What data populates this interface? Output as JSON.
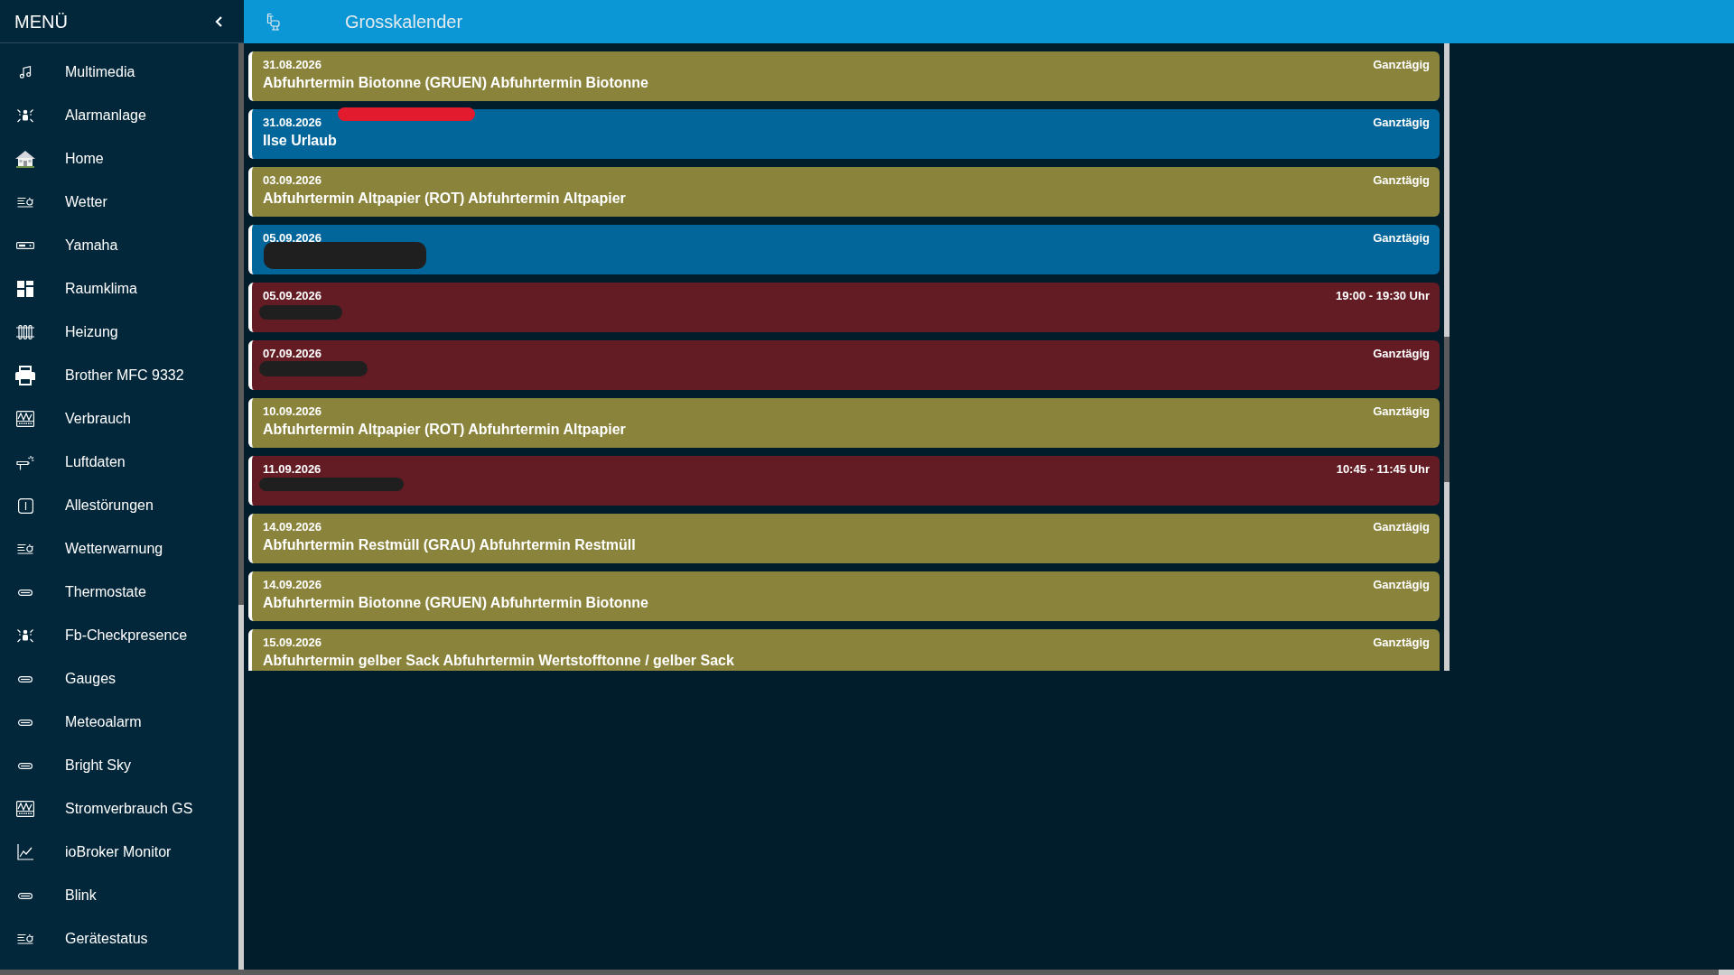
{
  "sidebar": {
    "title": "MENÜ",
    "items": [
      {
        "label": "Multimedia"
      },
      {
        "label": "Alarmanlage"
      },
      {
        "label": "Home"
      },
      {
        "label": "Wetter"
      },
      {
        "label": "Yamaha"
      },
      {
        "label": "Raumklima"
      },
      {
        "label": "Heizung"
      },
      {
        "label": "Brother MFC 9332"
      },
      {
        "label": "Verbrauch"
      },
      {
        "label": "Luftdaten"
      },
      {
        "label": "Allestörungen"
      },
      {
        "label": "Wetterwarnung"
      },
      {
        "label": "Thermostate"
      },
      {
        "label": "Fb-Checkpresence"
      },
      {
        "label": "Gauges"
      },
      {
        "label": "Meteoalarm"
      },
      {
        "label": "Bright Sky"
      },
      {
        "label": "Stromverbrauch GS"
      },
      {
        "label": "ioBroker Monitor"
      },
      {
        "label": "Blink"
      },
      {
        "label": "Gerätestatus"
      }
    ]
  },
  "top_bar": {
    "title": "Grosskalender"
  },
  "events": [
    {
      "date": "31.08.2026",
      "time": "Ganztägig",
      "title": "Abfuhrtermin Biotonne (GRUEN) Abfuhrtermin Biotonne",
      "color": "#8a833b"
    },
    {
      "date": "31.08.2026",
      "time": "Ganztägig",
      "title": "Ilse Urlaub",
      "color": "#03669a",
      "marked": true
    },
    {
      "date": "03.09.2026",
      "time": "Ganztägig",
      "title": "Abfuhrtermin Altpapier (ROT) Abfuhrtermin Altpapier",
      "color": "#8a833b"
    },
    {
      "date": "05.09.2026",
      "time": "Ganztägig",
      "color": "#03669a",
      "redacted": true
    },
    {
      "date": "05.09.2026",
      "time": "19:00 - 19:30 Uhr",
      "color": "#641c24",
      "redacted": true
    },
    {
      "date": "07.09.2026",
      "time": "Ganztägig",
      "color": "#641c24",
      "redacted": true
    },
    {
      "date": "10.09.2026",
      "time": "Ganztägig",
      "title": "Abfuhrtermin Altpapier (ROT) Abfuhrtermin Altpapier",
      "color": "#8a833b"
    },
    {
      "date": "11.09.2026",
      "time": "10:45 - 11:45 Uhr",
      "color": "#641c24",
      "redacted": true
    },
    {
      "date": "14.09.2026",
      "time": "Ganztägig",
      "title": "Abfuhrtermin Restmüll (GRAU) Abfuhrtermin Restmüll",
      "color": "#8a833b"
    },
    {
      "date": "14.09.2026",
      "time": "Ganztägig",
      "title": "Abfuhrtermin Biotonne (GRUEN) Abfuhrtermin Biotonne",
      "color": "#8a833b"
    },
    {
      "date": "15.09.2026",
      "time": "Ganztägig",
      "title": "Abfuhrtermin gelber Sack Abfuhrtermin Wertstofftonne / gelber Sack",
      "color": "#8a833b"
    }
  ]
}
